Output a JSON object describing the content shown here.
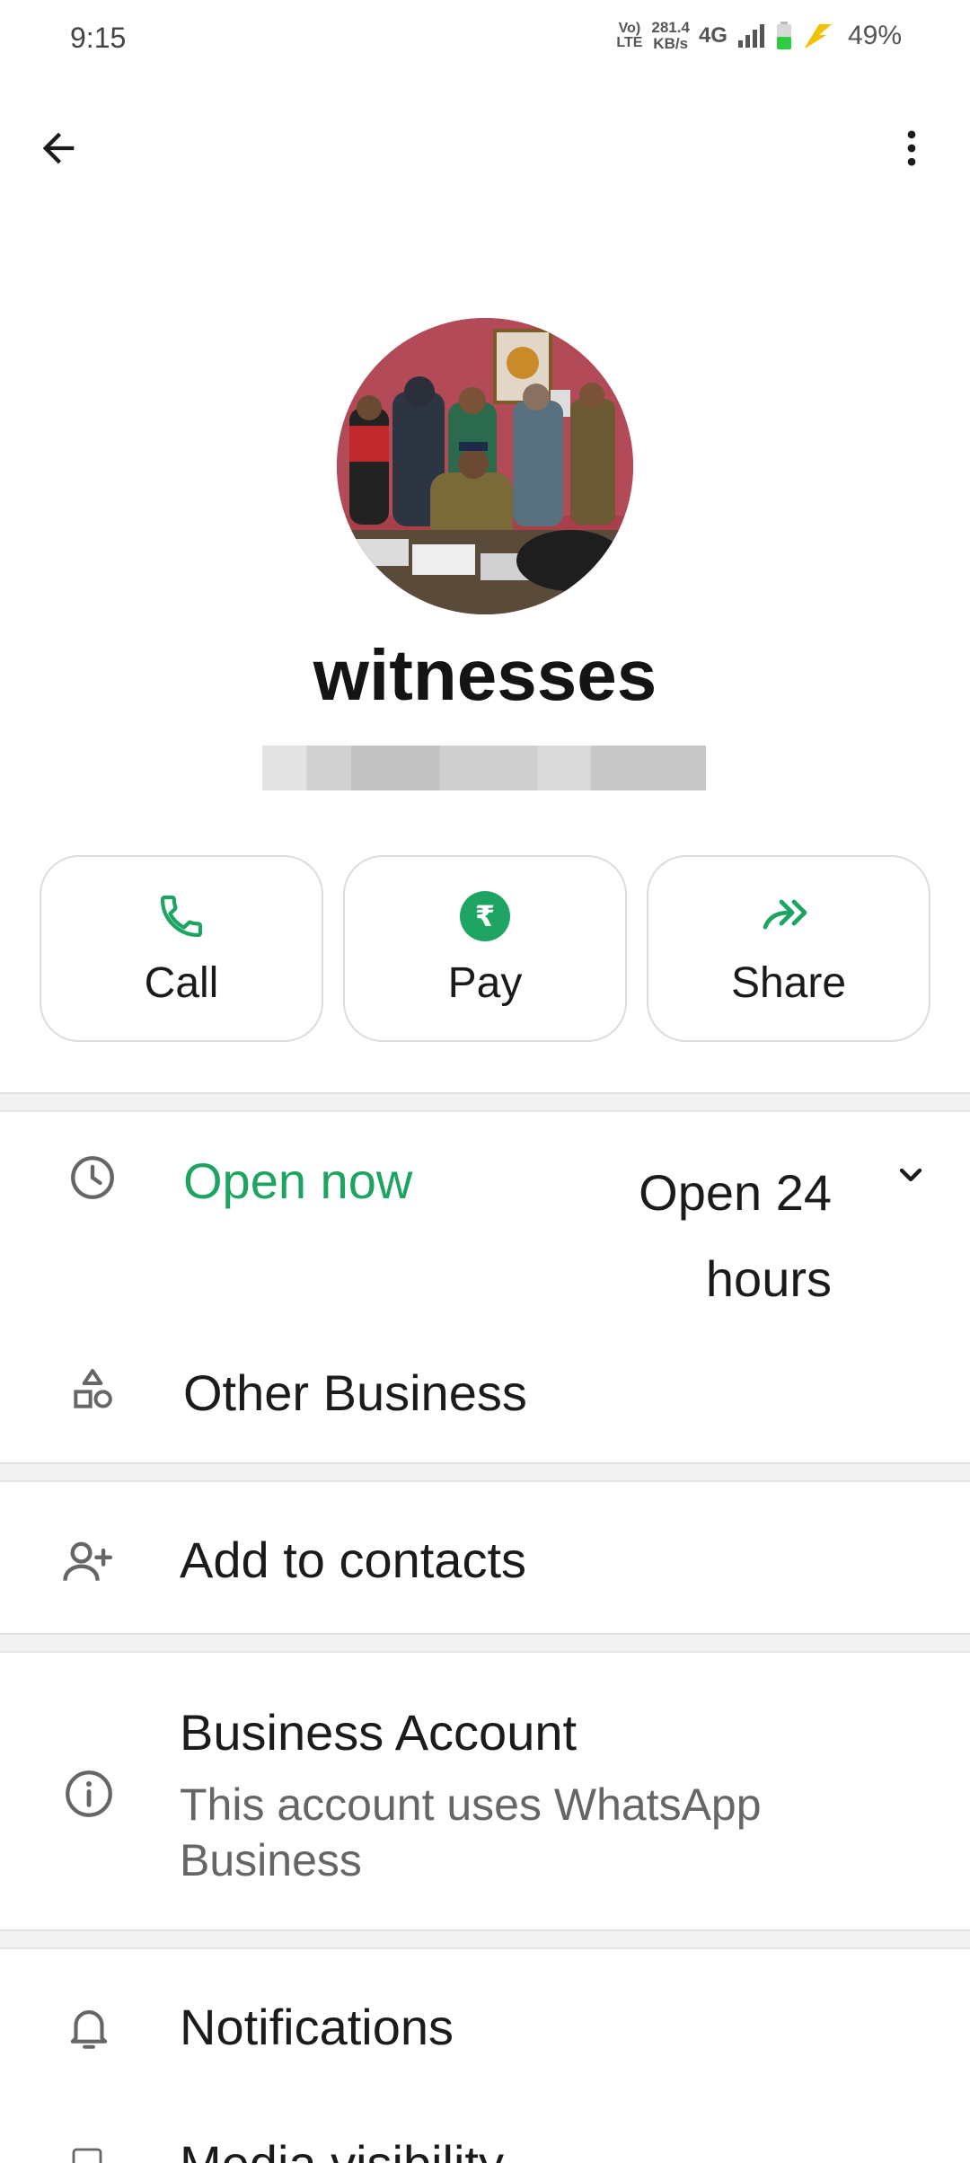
{
  "status_bar": {
    "time": "9:15",
    "volte": "Vo) LTE",
    "volte_line1": "Vo)",
    "volte_line2": "LTE",
    "speed_line1": "281.4",
    "speed_line2": "KB/s",
    "network": "4G",
    "battery": "49%"
  },
  "top_bar": {
    "back_icon": "arrow-back-icon",
    "menu_icon": "more-vert-icon"
  },
  "profile": {
    "name": "witnesses"
  },
  "actions": [
    {
      "label": "Call",
      "icon": "phone-icon"
    },
    {
      "label": "Pay",
      "icon": "rupee-icon"
    },
    {
      "label": "Share",
      "icon": "forward-icon"
    }
  ],
  "hours": {
    "status": "Open now",
    "detail_line1": "Open 24",
    "detail_line2": "hours"
  },
  "category": {
    "label": "Other Business"
  },
  "add_contacts": {
    "label": "Add to contacts"
  },
  "business_account": {
    "title": "Business Account",
    "subtitle": "This account uses WhatsApp Business"
  },
  "notifications": {
    "label": "Notifications"
  },
  "partial_row": {
    "label": "Media visibility"
  },
  "colors": {
    "accent_green": "#1da462",
    "pay_green": "#1da462"
  }
}
